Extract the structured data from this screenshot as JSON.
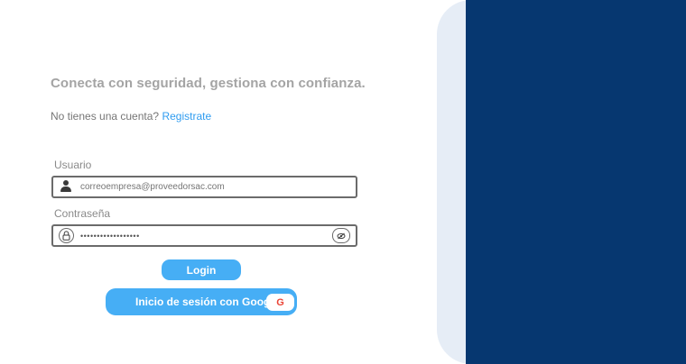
{
  "login": {
    "tagline": "Conecta con seguridad, gestiona con confianza.",
    "signup_prompt": "No tienes una cuenta?",
    "signup_link": "Registrate",
    "username_label": "Usuario",
    "username_placeholder": "correoempresa@proveedorsac.com",
    "password_label": "Contraseña",
    "password_value": "••••••••••••••••••",
    "login_button": "Login",
    "google_button": "Inicio de sesión con Google",
    "google_badge_letter": "G"
  },
  "icons": {
    "user": "user-icon",
    "lock": "lock-icon",
    "eye": "eye-slash-icon",
    "google": "google-icon"
  },
  "colors": {
    "panel_dark": "#063770",
    "panel_light": "#e6edf6",
    "accent": "#46aef5",
    "link": "#2f9cf0",
    "tagline": "#a4a4a4"
  }
}
